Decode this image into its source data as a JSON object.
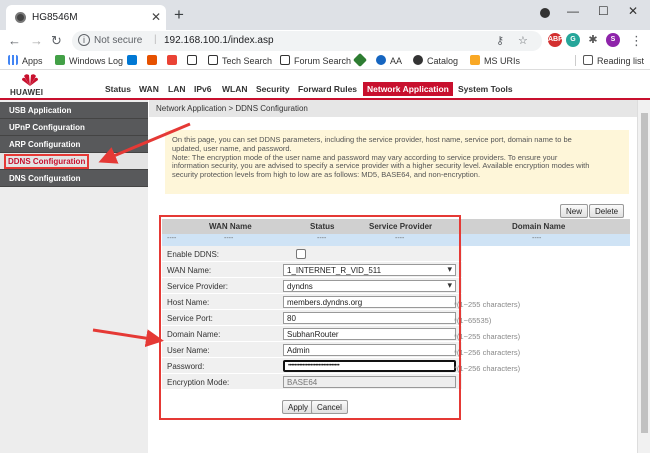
{
  "browser": {
    "tab_title": "HG8546M",
    "address_status": "Not secure",
    "url": "192.168.100.1/index.asp",
    "bookmarks": [
      "Apps",
      "Windows Log",
      "Tech Search",
      "Forum Search",
      "AA",
      "Catalog",
      "MS URIs"
    ],
    "reading_list": "Reading list",
    "ext_labels": [
      "ABP",
      "G",
      "S"
    ],
    "colors": {
      "accent": "#c8102e",
      "sidebar": "#58595b",
      "notice": "#fef6d9",
      "annotation": "#e53935"
    }
  },
  "router": {
    "brand": "HUAWEI",
    "menu": [
      "Status",
      "WAN",
      "LAN",
      "IPv6",
      "WLAN",
      "Security",
      "Forward Rules",
      "Network Application",
      "System Tools"
    ],
    "active_menu": "Network Application"
  },
  "sidebar": {
    "items": [
      {
        "label": "USB Application"
      },
      {
        "label": "UPnP Configuration"
      },
      {
        "label": "ARP Configuration"
      },
      {
        "label": "DDNS Configuration"
      },
      {
        "label": "DNS Configuration"
      }
    ],
    "selected": "DDNS Configuration"
  },
  "main": {
    "breadcrumb": "Network Application > DDNS Configuration",
    "notice_lines": [
      "On this page, you can set DDNS parameters, including the service provider, host name, service port, domain name to be",
      "updated, user name, and password.",
      "Note: The encryption mode of the user name and password may vary according to service providers. To ensure your",
      "information security, you are advised to specify a service provider with a higher security level. Available encryption modes with",
      "security protection levels from high to low are as follows: MD5, BASE64, and non-encryption."
    ],
    "new_label": "New",
    "delete_label": "Delete",
    "table": {
      "headers": [
        "WAN Name",
        "Status",
        "Service Provider",
        "Domain Name"
      ],
      "row": [
        "----",
        "----",
        "----",
        "----",
        "----"
      ]
    },
    "form": {
      "enable_label": "Enable DDNS:",
      "enable_checked": false,
      "wan_label": "WAN Name:",
      "wan_value": "1_INTERNET_R_VID_511",
      "provider_label": "Service Provider:",
      "provider_value": "dyndns",
      "host_label": "Host Name:",
      "host_value": "members.dyndns.org",
      "host_hint": "*(1~255 characters)",
      "port_label": "Service Port:",
      "port_value": "80",
      "port_hint": "*(1~65535)",
      "domain_label": "Domain Name:",
      "domain_value": "SubhanRouter",
      "domain_hint": "*(1~255 characters)",
      "user_label": "User Name:",
      "user_value": "Admin",
      "user_hint": "*(1~256 characters)",
      "pass_label": "Password:",
      "pass_value": "••••••••••••••••••••••••••••••••",
      "pass_hint": "*(1~256 characters)",
      "enc_label": "Encryption Mode:",
      "enc_value": "BASE64"
    },
    "apply_label": "Apply",
    "cancel_label": "Cancel"
  }
}
